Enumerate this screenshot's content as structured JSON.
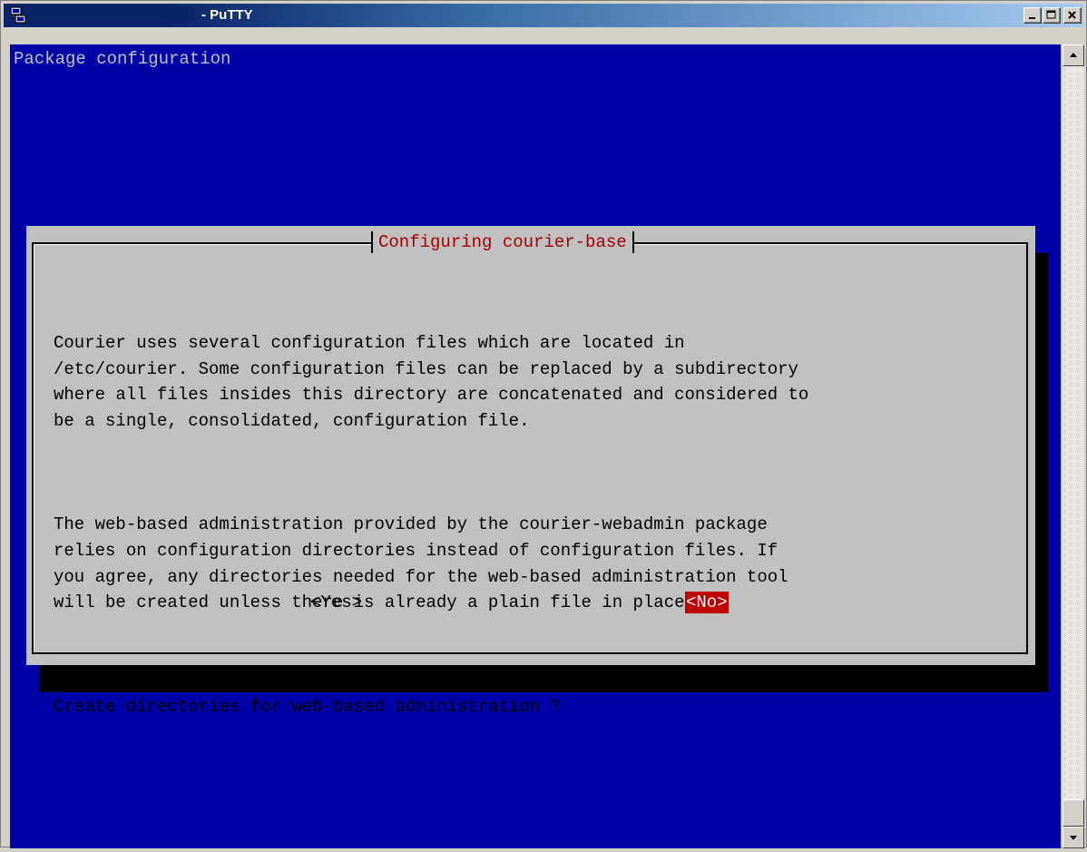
{
  "window": {
    "title": "- PuTTY",
    "icon": "putty-icon",
    "controls": [
      "minimize-icon",
      "maximize-icon",
      "close-icon"
    ]
  },
  "terminal": {
    "header": "Package configuration"
  },
  "dialog": {
    "title": "Configuring courier-base",
    "paragraphs": [
      "Courier uses several configuration files which are located in\n/etc/courier. Some configuration files can be replaced by a subdirectory\nwhere all files insides this directory are concatenated and considered to\nbe a single, consolidated, configuration file.",
      "The web-based administration provided by the courier-webadmin package\nrelies on configuration directories instead of configuration files. If\nyou agree, any directories needed for the web-based administration tool\nwill be created unless there is already a plain file in place.",
      "Create directories for web-based administration ?"
    ],
    "yes_label": "<Yes>",
    "no_label": "<No>"
  },
  "colors": {
    "terminal_bg": "#0000a8",
    "dialog_bg": "#c0c0c0",
    "title_fg": "#a80000",
    "selected_bg": "#c00000"
  }
}
